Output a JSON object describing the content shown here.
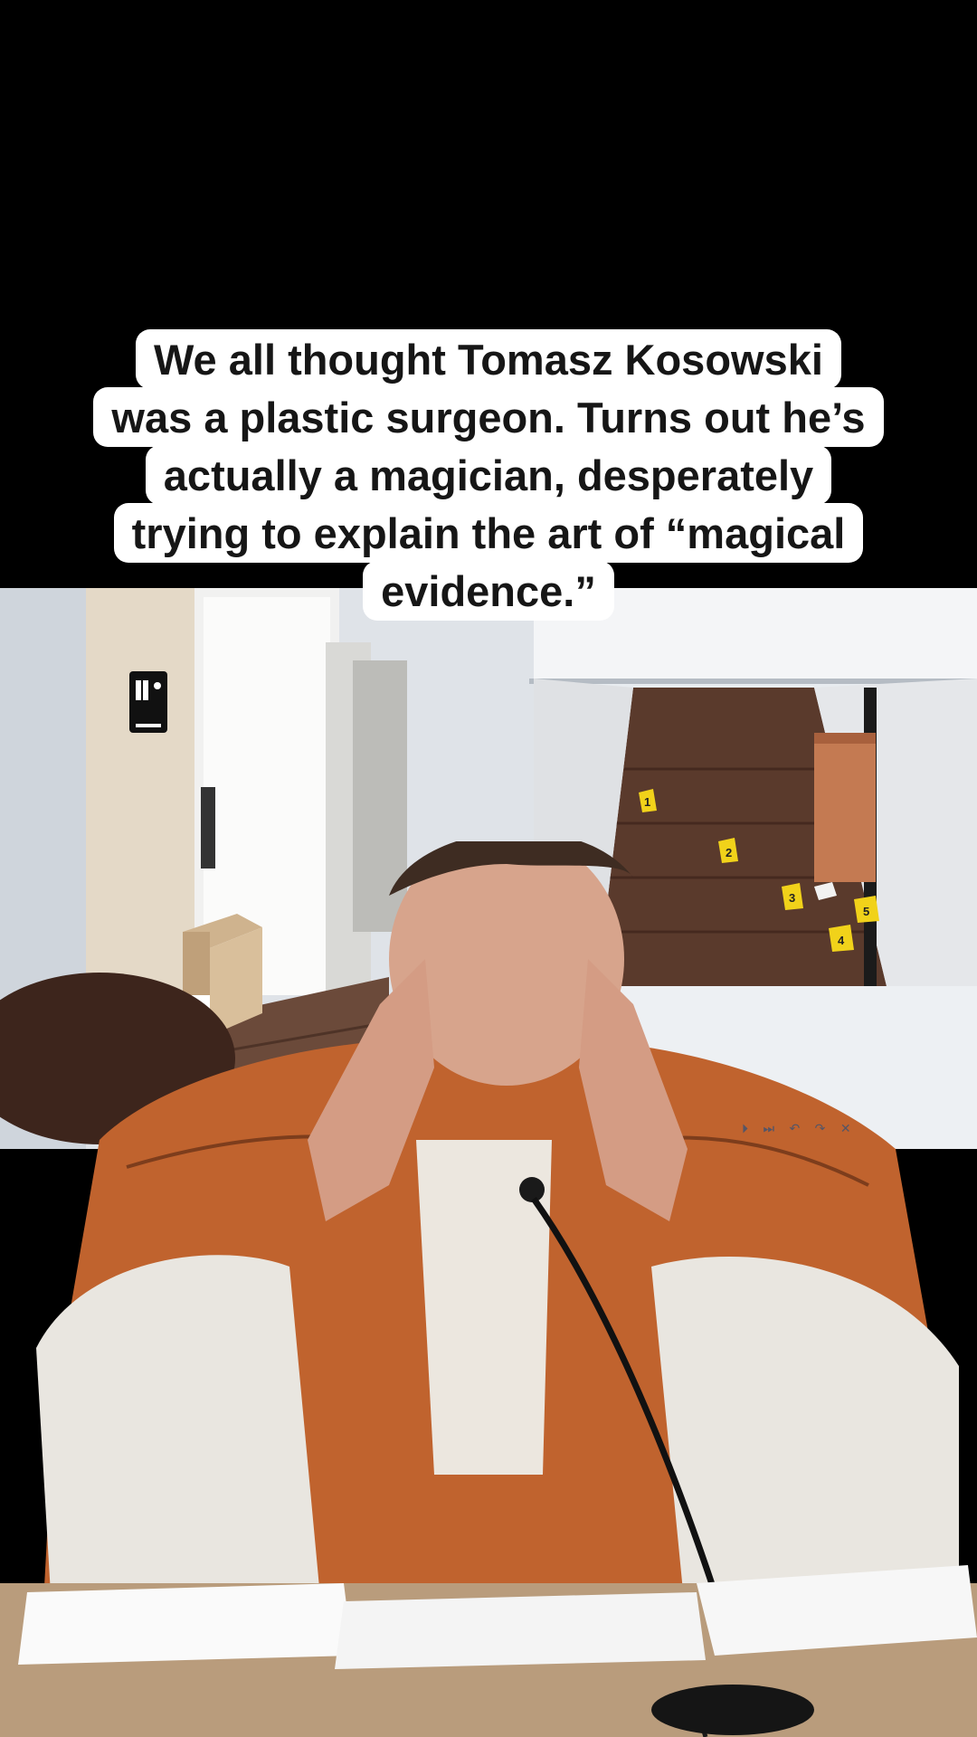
{
  "caption": {
    "lines": [
      "We all thought Tomasz Kosowski",
      "was a plastic surgeon. Turns out he’s",
      "actually a magician, desperately",
      "trying to explain the art of “magical",
      "evidence.”"
    ]
  },
  "footage": {
    "restroom_sign": "restroom-accessible-icon",
    "evidence_markers": [
      "1",
      "2",
      "3",
      "4",
      "5"
    ],
    "controls": "⏵ ⏭ ↶ ↷ ✕"
  },
  "colors": {
    "background": "#000000",
    "caption_bg": "#ffffff",
    "caption_text": "#161616",
    "jumpsuit": "#c0632e",
    "marker": "#f1d21a",
    "floor": "#5a3a2c"
  }
}
